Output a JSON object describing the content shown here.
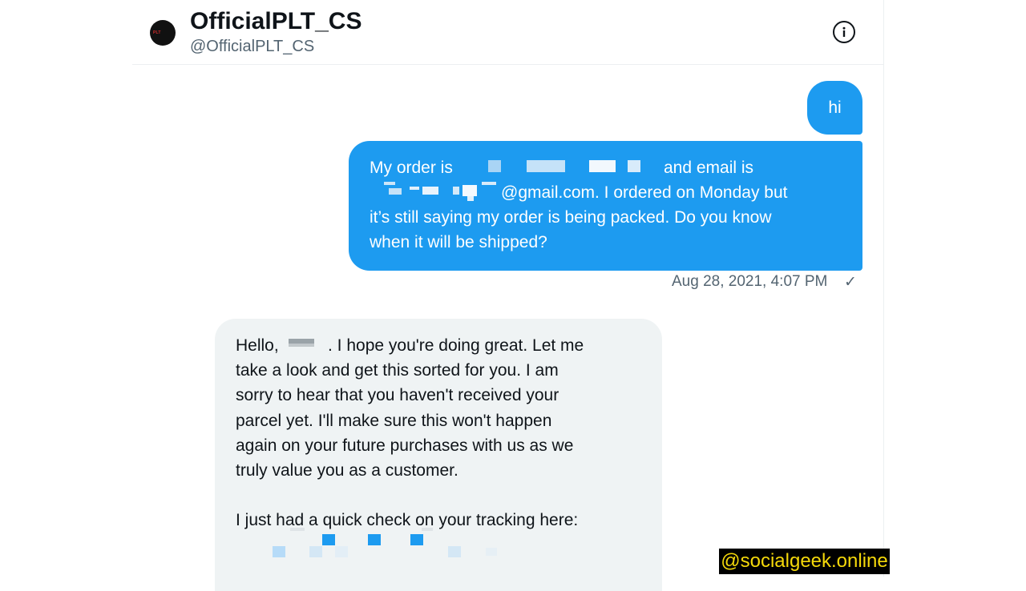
{
  "header": {
    "account_name": "OfficialPLT_CS",
    "account_handle": "@OfficialPLT_CS",
    "avatar_icon": "brand-logo-avatar",
    "info_icon": "info-circle-icon"
  },
  "messages": {
    "sent_hi": "hi",
    "sent_order": {
      "line1_a": "My order is",
      "line1_b": "and email is",
      "line2_b": "@gmail.com. I ordered on Monday but",
      "line3": "it’s still saying my order is being packed. Do you know",
      "line4": "when it will be shipped?"
    },
    "timestamp": "Aug 28, 2021, 4:07 PM",
    "read_mark": "✓",
    "reply": {
      "line1_a": "Hello,",
      "line1_b": ". I hope you're doing great. Let me",
      "line2": "take a look and get this sorted for you. I am",
      "line3": "sorry to hear that you haven't received your",
      "line4": "parcel yet. I'll make sure this won't happen",
      "line5": "again on your future purchases with us as we",
      "line6": "truly value you as a customer.",
      "line7": "I just had a quick check on your tracking here:"
    }
  },
  "watermark": "@socialgeek.online",
  "colors": {
    "sent_bubble": "#1d9bf0",
    "received_bubble": "#eff3f4",
    "watermark_bg": "#000000",
    "watermark_text": "#f5d90a"
  }
}
